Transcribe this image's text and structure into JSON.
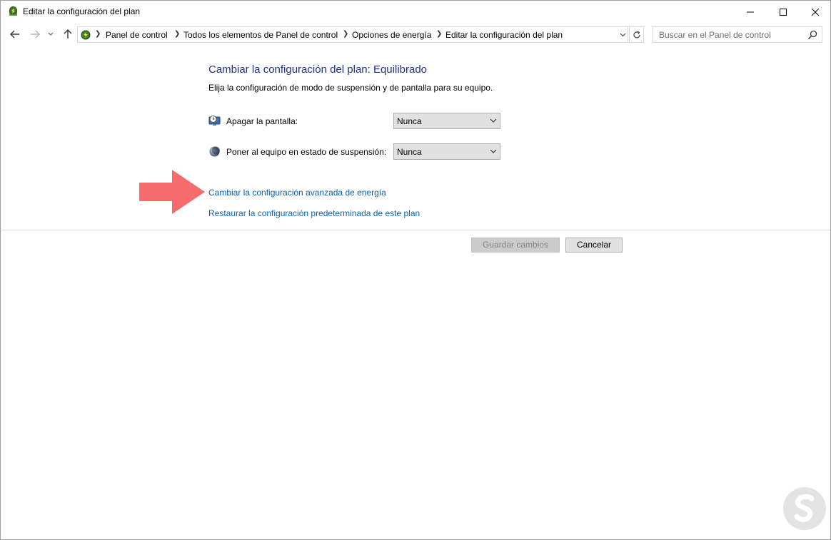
{
  "window": {
    "title": "Editar la configuración del plan"
  },
  "address_bar": {
    "breadcrumbs": [
      "Panel de control",
      "Todos los elementos de Panel de control",
      "Opciones de energía",
      "Editar la configuración del plan"
    ]
  },
  "search": {
    "placeholder": "Buscar en el Panel de control"
  },
  "main": {
    "heading": "Cambiar la configuración del plan: Equilibrado",
    "subheading": "Elija la configuración de modo de suspensión y de pantalla para su equipo.",
    "settings": [
      {
        "label": "Apagar la pantalla:",
        "value": "Nunca",
        "icon": "monitor-clock-icon"
      },
      {
        "label": "Poner al equipo en estado de suspensión:",
        "value": "Nunca",
        "icon": "moon-icon"
      }
    ],
    "links": {
      "advanced": "Cambiar la configuración avanzada de energía",
      "restore": "Restaurar la configuración predeterminada de este plan"
    }
  },
  "buttons": {
    "save": "Guardar cambios",
    "cancel": "Cancelar"
  },
  "colors": {
    "heading": "#1e3287",
    "link": "#0b61b0",
    "annotation_arrow": "#f66b6b"
  }
}
